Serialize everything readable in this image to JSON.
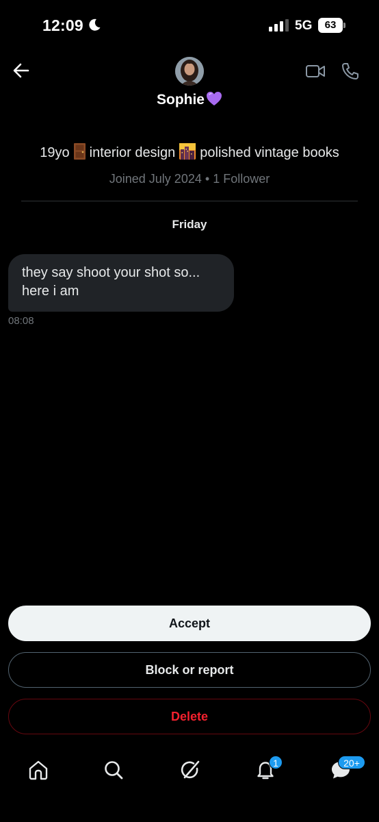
{
  "status_bar": {
    "time": "12:09",
    "network": "5G",
    "battery": "63",
    "icons": [
      "moon-icon",
      "signal-icon"
    ]
  },
  "header": {
    "contact_name": "Sophie",
    "icons": [
      "back-arrow-icon",
      "video-call-icon",
      "phone-icon",
      "purple-heart-icon"
    ]
  },
  "profile": {
    "bio_parts": [
      "19yo",
      "interior design",
      "polished vintage books"
    ],
    "bio_emojis": [
      "door-emoji",
      "cityscape-at-dusk-emoji"
    ],
    "joined": "Joined July 2024",
    "separator": "•",
    "followers": "1 Follower"
  },
  "conversation": {
    "day_label": "Friday",
    "messages": [
      {
        "line1": "they say shoot your shot so...",
        "line2": "here i am",
        "time": "08:08"
      }
    ]
  },
  "actions": {
    "accept_label": "Accept",
    "block_label": "Block or report",
    "delete_label": "Delete"
  },
  "bottom_nav": {
    "items": [
      "home-icon",
      "search-icon",
      "grok-icon",
      "notifications-bell-icon",
      "messages-icon"
    ],
    "notifications_badge": "1",
    "messages_badge": "20+"
  },
  "colors": {
    "background": "#000000",
    "bubble": "#202327",
    "accent_blue": "#1d9bf0",
    "delete_red": "#f4212e",
    "muted_text": "#71767b"
  }
}
